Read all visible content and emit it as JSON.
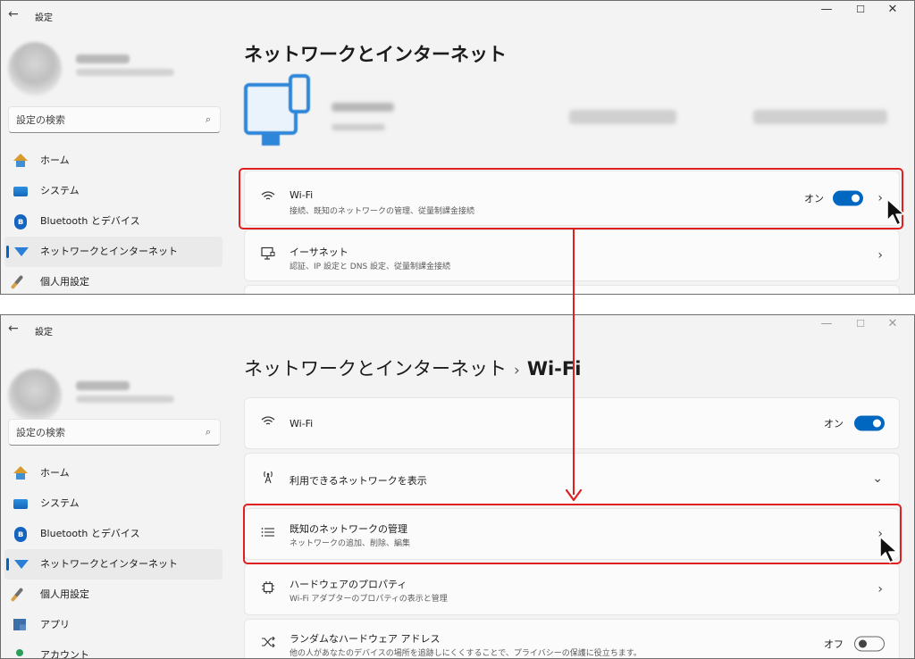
{
  "window": {
    "title": "設定",
    "back_glyph": "←",
    "min_glyph": "—",
    "max_glyph": "☐",
    "close_glyph": "✕"
  },
  "search": {
    "placeholder": "設定の検索"
  },
  "sidebar": {
    "items": [
      {
        "label": "ホーム",
        "icon": "home-icon"
      },
      {
        "label": "システム",
        "icon": "system-icon"
      },
      {
        "label": "Bluetooth とデバイス",
        "icon": "bluetooth-icon"
      },
      {
        "label": "ネットワークとインターネット",
        "icon": "network-icon",
        "active": true
      },
      {
        "label": "個人用設定",
        "icon": "brush-icon"
      },
      {
        "label": "アプリ",
        "icon": "apps-icon"
      },
      {
        "label": "アカウント",
        "icon": "account-icon"
      }
    ]
  },
  "top": {
    "page_title": "ネットワークとインターネット",
    "wifi": {
      "title": "Wi-Fi",
      "subtitle": "接続、既知のネットワークの管理、従量制課金接続",
      "state": "オン",
      "chevron": "›"
    },
    "ethernet": {
      "title": "イーサネット",
      "subtitle": "認証、IP 設定と DNS 設定、従量制課金接続",
      "chevron": "›"
    }
  },
  "bottom": {
    "breadcrumb_parent": "ネットワークとインターネット",
    "breadcrumb_sep": "›",
    "breadcrumb_current": "Wi-Fi",
    "wifi": {
      "title": "Wi-Fi",
      "state": "オン"
    },
    "available": {
      "title": "利用できるネットワークを表示",
      "chevron": "⌄"
    },
    "known": {
      "title": "既知のネットワークの管理",
      "subtitle": "ネットワークの追加、削除、編集",
      "chevron": "›"
    },
    "hardware": {
      "title": "ハードウェアのプロパティ",
      "subtitle": "Wi-Fi アダプターのプロパティの表示と管理",
      "chevron": "›"
    },
    "random": {
      "title": "ランダムなハードウェア アドレス",
      "subtitle": "他の人があなたのデバイスの場所を追跡しにくくすることで、プライバシーの保護に役立ちます。",
      "state": "オフ"
    }
  },
  "toggles": {
    "top_wifi": true,
    "bottom_wifi": true,
    "random_address": false
  },
  "colors": {
    "accent": "#0067c0",
    "highlight": "#e02020"
  }
}
